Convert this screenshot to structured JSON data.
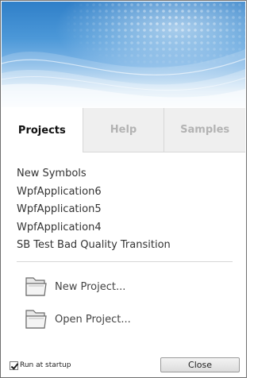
{
  "tabs": [
    {
      "label": "Projects",
      "active": true
    },
    {
      "label": "Help",
      "active": false
    },
    {
      "label": "Samples",
      "active": false
    }
  ],
  "recent_projects": [
    "New Symbols",
    "WpfApplication6",
    "WpfApplication5",
    "WpfApplication4",
    "SB Test Bad Quality Transition"
  ],
  "actions": {
    "new_project": {
      "label": "New Project...",
      "icon": "folder-icon"
    },
    "open_project": {
      "label": "Open Project...",
      "icon": "folder-icon"
    }
  },
  "footer": {
    "run_at_startup_label": "Run at startup",
    "run_at_startup_checked": true,
    "close_label": "Close"
  },
  "colors": {
    "banner_blue": "#2f7fc8",
    "active_tab_text": "#111111",
    "inactive_tab_text": "#b3b3b3"
  }
}
